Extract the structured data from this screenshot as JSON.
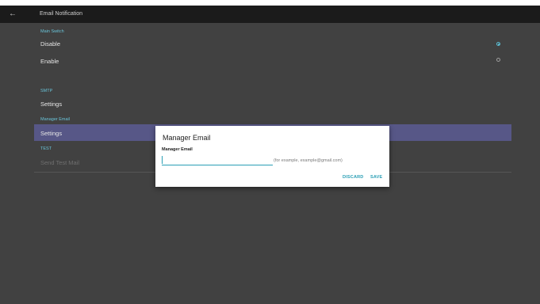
{
  "appbar": {
    "title": "Email Notification"
  },
  "sections": {
    "main_switch": {
      "label": "Main Switch",
      "disable": "Disable",
      "enable": "Enable",
      "selected": "Disable"
    },
    "smtp": {
      "label": "SMTP",
      "settings": "Settings"
    },
    "manager_email": {
      "label": "Manager Email",
      "settings": "Settings"
    },
    "test": {
      "label": "TEST",
      "send": "Send Test Mail"
    }
  },
  "dialog": {
    "title": "Manager Email",
    "field_label": "Manager Email",
    "input_value": "",
    "hint": "(for example, example@gmail.com)",
    "discard": "DISCARD",
    "save": "SAVE"
  },
  "colors": {
    "accent": "#2a9fb5",
    "section": "#69c3d8",
    "highlight": "#575787",
    "appbar": "#1b1b1b",
    "background": "#414141"
  }
}
